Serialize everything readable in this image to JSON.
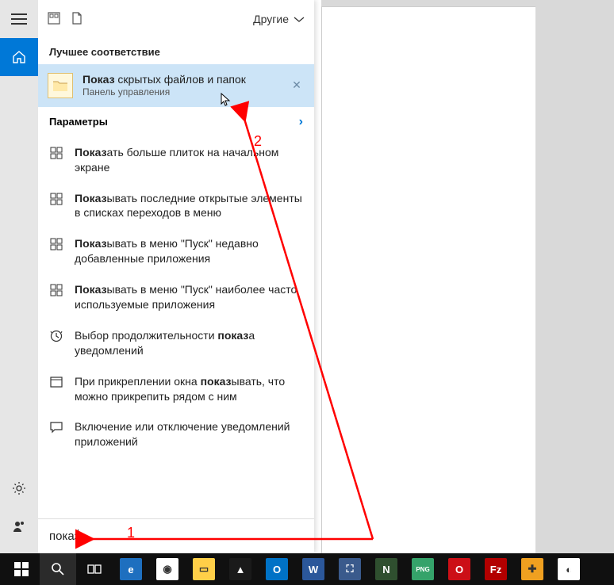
{
  "header": {
    "filter_label": "Другие"
  },
  "sections": {
    "best_match_label": "Лучшее соответствие",
    "settings_label": "Параметры"
  },
  "best_match": {
    "bold": "Показ",
    "rest": " скрытых файлов и папок",
    "subtitle": "Панель управления"
  },
  "settings_items": [
    {
      "icon": "tiles",
      "bold": "Показ",
      "rest": "ать больше плиток на начальном экране"
    },
    {
      "icon": "tiles",
      "bold": "Показ",
      "rest": "ывать последние открытые элементы в списках переходов в меню"
    },
    {
      "icon": "tiles",
      "bold": "Показ",
      "rest": "ывать в меню \"Пуск\" недавно добавленные приложения"
    },
    {
      "icon": "tiles",
      "bold": "Показ",
      "rest": "ывать в меню \"Пуск\" наиболее часто используемые приложения"
    },
    {
      "icon": "clock",
      "pre": "Выбор продолжительности ",
      "bold": "показ",
      "rest": "а уведомлений"
    },
    {
      "icon": "window",
      "pre": "При прикреплении окна ",
      "bold": "показ",
      "rest": "ывать, что можно прикрепить рядом с ним"
    },
    {
      "icon": "chat",
      "pre": "Включение или отключение уведомлений приложений",
      "bold": "",
      "rest": ""
    }
  ],
  "search": {
    "value": "показ"
  },
  "annotations": {
    "label1": "1",
    "label2": "2"
  },
  "taskbar_apps": [
    {
      "name": "internet-explorer",
      "bg": "#1e6fbf",
      "glyph": "e"
    },
    {
      "name": "chrome",
      "bg": "#ffffff",
      "glyph": "◉"
    },
    {
      "name": "file-explorer",
      "bg": "#ffcf48",
      "glyph": "▭"
    },
    {
      "name": "aimp",
      "bg": "#1a1a1a",
      "glyph": "▲"
    },
    {
      "name": "outlook",
      "bg": "#0072c6",
      "glyph": "O"
    },
    {
      "name": "word",
      "bg": "#2b579a",
      "glyph": "W"
    },
    {
      "name": "paintnet",
      "bg": "#3a5a8c",
      "glyph": "⛶"
    },
    {
      "name": "notepadpp",
      "bg": "#2f4f2f",
      "glyph": "N"
    },
    {
      "name": "png-tool",
      "bg": "#35a36a",
      "glyph": "PNG"
    },
    {
      "name": "opera",
      "bg": "#cc0f16",
      "glyph": "O"
    },
    {
      "name": "filezilla",
      "bg": "#b30000",
      "glyph": "Fz"
    },
    {
      "name": "tool",
      "bg": "#f0a020",
      "glyph": "✚"
    },
    {
      "name": "picasa",
      "bg": "#ffffff",
      "glyph": "◐"
    }
  ]
}
